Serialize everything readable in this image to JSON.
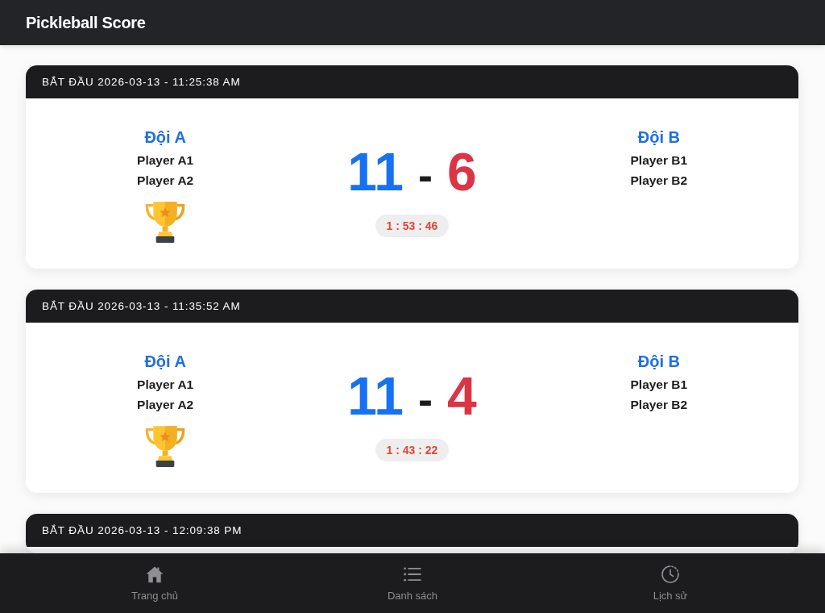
{
  "app_bar": {
    "title": "Pickleball Score"
  },
  "matches": [
    {
      "started": "BẮT ĐẦU 2026-03-13 - 11:25:38 AM",
      "teams": [
        {
          "name": "Đội A",
          "players": [
            "Player A1",
            "Player A2"
          ],
          "winner": true
        },
        {
          "name": "Đội B",
          "players": [
            "Player B1",
            "Player B2"
          ],
          "winner": false
        }
      ],
      "score": {
        "team_a": "11",
        "separator": "-",
        "team_b": "6"
      },
      "duration": "1 : 53 : 46"
    },
    {
      "started": "BẮT ĐẦU 2026-03-13 - 11:35:52 AM",
      "teams": [
        {
          "name": "Đội A",
          "players": [
            "Player A1",
            "Player A2"
          ],
          "winner": true
        },
        {
          "name": "Đội B",
          "players": [
            "Player B1",
            "Player B2"
          ],
          "winner": false
        }
      ],
      "score": {
        "team_a": "11",
        "separator": "-",
        "team_b": "4"
      },
      "duration": "1 : 43 : 22"
    },
    {
      "started": "BẮT ĐẦU 2026-03-13 - 12:09:38 PM"
    }
  ],
  "bottom_nav": [
    {
      "kind": "home",
      "label": "Trang chủ",
      "selected": false
    },
    {
      "kind": "list",
      "label": "Danh sách",
      "selected": false
    },
    {
      "kind": "history",
      "label": "Lịch sử",
      "selected": false
    }
  ]
}
